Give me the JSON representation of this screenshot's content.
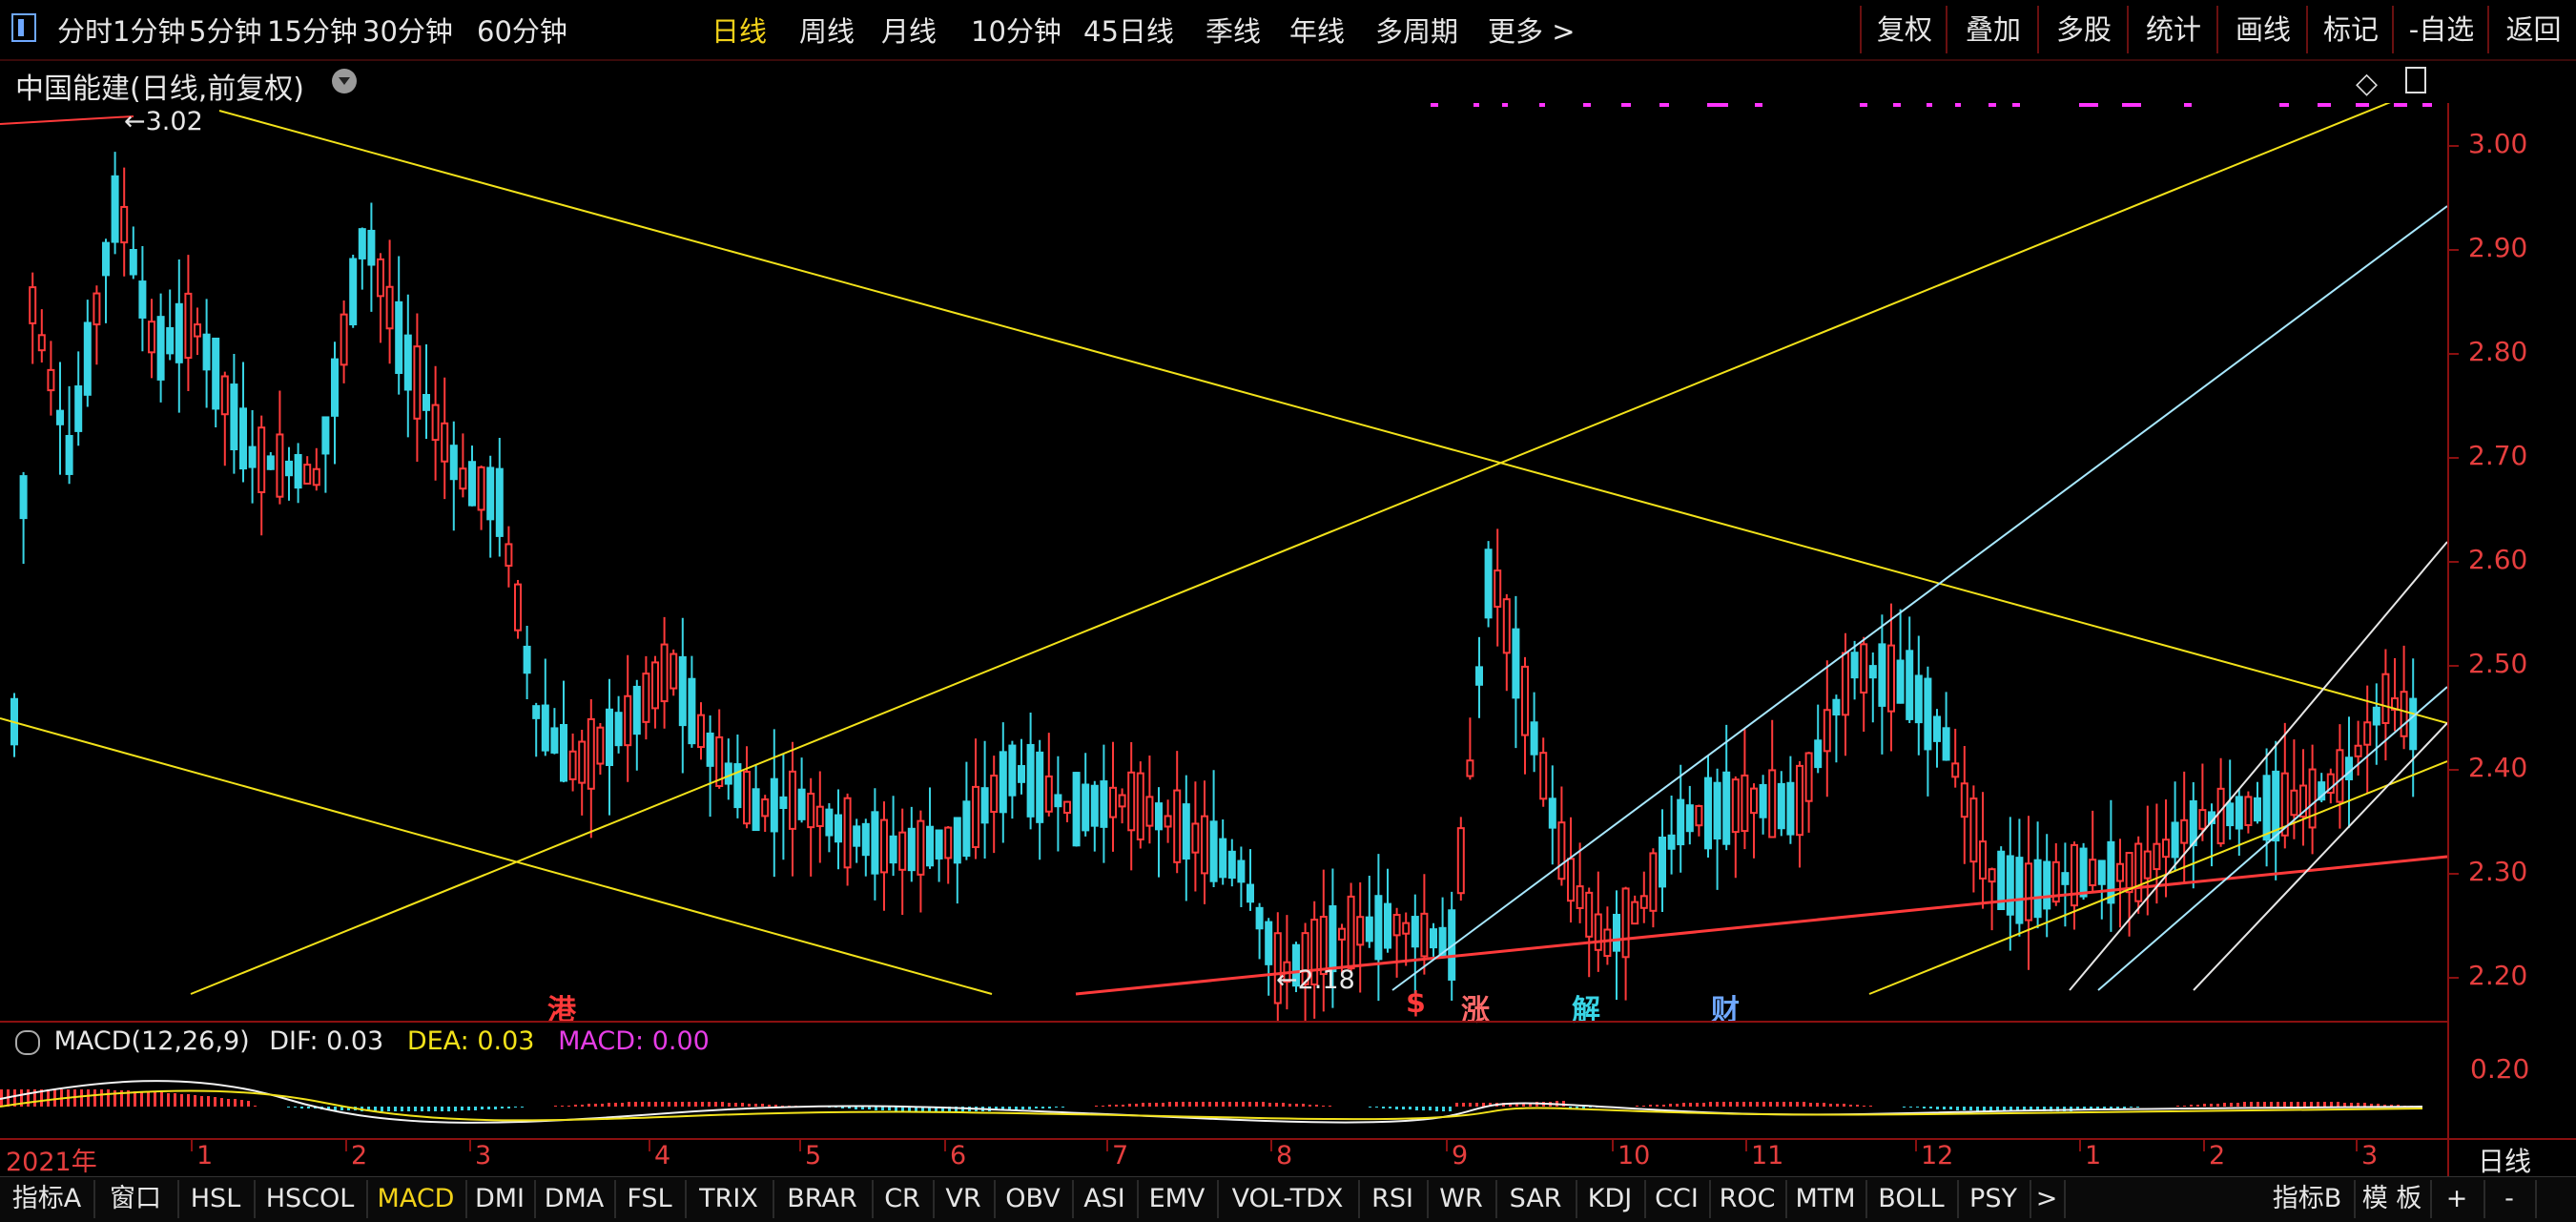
{
  "toolbar": {
    "periods": [
      "分时",
      "1分钟",
      "5分钟",
      "15分钟",
      "30分钟",
      "60分钟",
      "日线",
      "周线",
      "月线",
      "10分钟",
      "45日线",
      "季线",
      "年线",
      "多周期",
      "更多 >"
    ],
    "active_period": "日线",
    "right_buttons": [
      "复权",
      "叠加",
      "多股",
      "统计",
      "画线",
      "标记",
      "-自选",
      "返回"
    ]
  },
  "chart": {
    "title": "中国能建(日线,前复权)",
    "price_labels": [
      "3.00",
      "2.90",
      "2.80",
      "2.70",
      "2.60",
      "2.50",
      "2.40",
      "2.30",
      "2.20"
    ],
    "high_label": "3.02",
    "low_label": "2.18",
    "markers": [
      {
        "text": "港",
        "color": "#ff3a3a"
      },
      {
        "text": "$",
        "color": "#ff3a3a"
      },
      {
        "text": "涨",
        "color": "#ff6a6a"
      },
      {
        "text": "解",
        "color": "#39d5e5"
      },
      {
        "text": "财",
        "color": "#6fa8ff"
      }
    ]
  },
  "macd": {
    "name": "MACD(12,26,9)",
    "dif": "DIF: 0.03",
    "dea": "DEA: 0.03",
    "macd": "MACD: 0.00",
    "axis_label": "0.20"
  },
  "months": [
    "2021年",
    "1",
    "2",
    "3",
    "4",
    "5",
    "6",
    "7",
    "8",
    "9",
    "10",
    "11",
    "12",
    "1",
    "2",
    "3"
  ],
  "period_label": "日线",
  "tabs": [
    "指标A",
    "窗口",
    "HSL",
    "HSCOL",
    "MACD",
    "DMI",
    "DMA",
    "FSL",
    "TRIX",
    "BRAR",
    "CR",
    "VR",
    "OBV",
    "ASI",
    "EMV",
    "VOL-TDX",
    "RSI",
    "WR",
    "SAR",
    "KDJ",
    "CCI",
    "ROC",
    "MTM",
    "BOLL",
    "PSY",
    ">",
    "指标B",
    "模 板",
    "+",
    "-"
  ],
  "active_tab": "MACD",
  "colors": {
    "up": "#ff3a3a",
    "down": "#39d5e5",
    "trend": "#f2e21a",
    "frame": "#8a1010"
  }
}
